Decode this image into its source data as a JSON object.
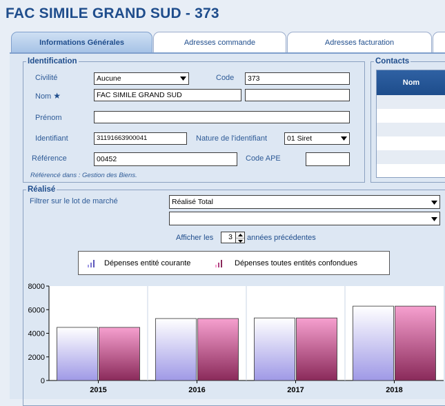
{
  "title": "FAC SIMILE GRAND SUD  -  373",
  "tabs": [
    "Informations Générales",
    "Adresses commande",
    "Adresses facturation"
  ],
  "identification": {
    "legend": "Identification",
    "civilite_label": "Civilité",
    "civilite_value": "Aucune",
    "code_label": "Code",
    "code_value": "373",
    "nom_label": "Nom",
    "nom_value": "FAC SIMILE GRAND SUD",
    "nom2_value": "",
    "prenom_label": "Prénom",
    "prenom_value": "",
    "identifiant_label": "Identifiant",
    "identifiant_value": "31191663900041",
    "nature_label": "Nature de l'identifiant",
    "nature_value": "01 Siret",
    "reference_label": "Référence",
    "reference_value": "00452",
    "code_ape_label": "Code APE",
    "code_ape_value": "",
    "referenced_note": "Référencé dans : Gestion des Biens."
  },
  "contacts": {
    "legend": "Contacts",
    "column_header": "Nom"
  },
  "realise": {
    "legend": "Réalisé",
    "filter_label": "Filtrer sur le lot de marché",
    "filter_value": "Réalisé Total",
    "filter2_value": "",
    "afficher_prefix": "Afficher les",
    "years_value": "3",
    "afficher_suffix": "années précédentes",
    "legend_current": "Dépenses entité courante",
    "legend_all": "Dépenses toutes entités confondues"
  },
  "colors": {
    "title": "#1f4d8c",
    "label": "#2d5a96",
    "bar_current_top": "#ffffff",
    "bar_current_bottom": "#9f99e6",
    "bar_all_top": "#f6a0cf",
    "bar_all_bottom": "#8a2a5a"
  },
  "chart_data": {
    "type": "bar",
    "categories": [
      "2015",
      "2016",
      "2017",
      "2018"
    ],
    "series": [
      {
        "name": "Dépenses entité courante",
        "values": [
          4500,
          5250,
          5300,
          6300
        ]
      },
      {
        "name": "Dépenses toutes entités confondues",
        "values": [
          4500,
          5250,
          5300,
          6300
        ]
      }
    ],
    "yticks": [
      "0",
      "2000",
      "4000",
      "6000",
      "8000"
    ],
    "ylim": [
      0,
      8000
    ],
    "grid": false,
    "legend_position": "top"
  }
}
